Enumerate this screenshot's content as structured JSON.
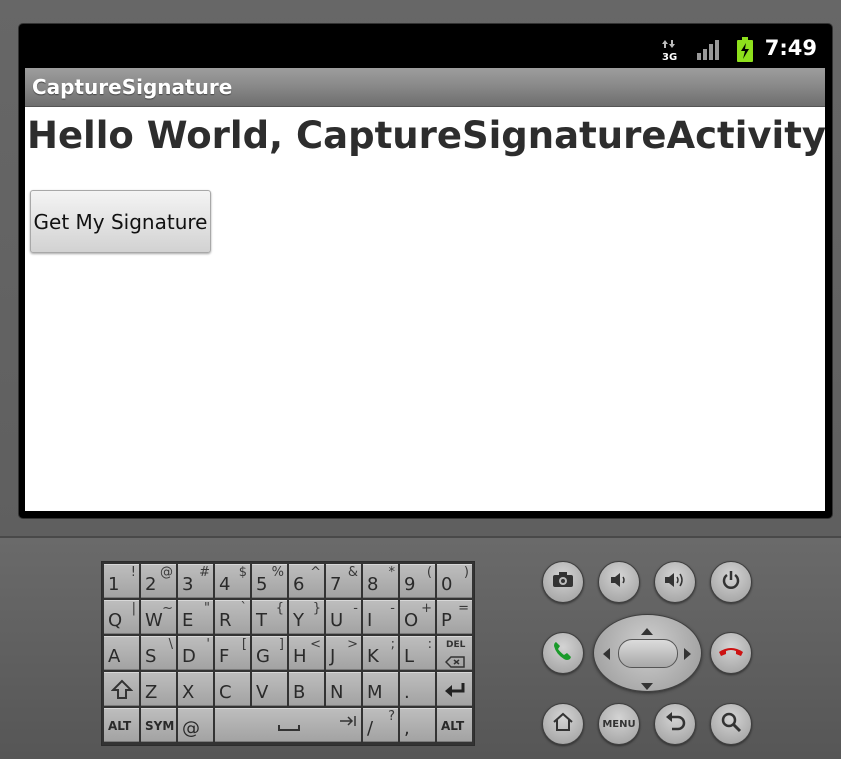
{
  "status_bar": {
    "clock": "7:49",
    "network_type": "3G"
  },
  "app": {
    "title": "CaptureSignature",
    "hello_text": "Hello World, CaptureSignatureActivity!",
    "signature_button": "Get My Signature"
  },
  "keyboard": {
    "rows": [
      [
        [
          "1",
          "!"
        ],
        [
          "2",
          "@"
        ],
        [
          "3",
          "#"
        ],
        [
          "4",
          "$"
        ],
        [
          "5",
          "%"
        ],
        [
          "6",
          "^"
        ],
        [
          "7",
          "&"
        ],
        [
          "8",
          "*"
        ],
        [
          "9",
          "("
        ],
        [
          "0",
          ")"
        ]
      ],
      [
        [
          "Q",
          "|"
        ],
        [
          "W",
          "~"
        ],
        [
          "E",
          "\""
        ],
        [
          "R",
          "`"
        ],
        [
          "T",
          "{"
        ],
        [
          "Y",
          "}"
        ],
        [
          "U",
          "-"
        ],
        [
          "I",
          "-"
        ],
        [
          "O",
          "+"
        ],
        [
          "P",
          "="
        ]
      ],
      [
        [
          "A",
          ""
        ],
        [
          "S",
          "\\"
        ],
        [
          "D",
          "'"
        ],
        [
          "F",
          "["
        ],
        [
          "G",
          "]"
        ],
        [
          "H",
          "<"
        ],
        [
          "J",
          ">"
        ],
        [
          "K",
          ";"
        ],
        [
          "L",
          ":"
        ]
      ],
      [
        [
          "Z",
          ""
        ],
        [
          "X",
          ""
        ],
        [
          "C",
          ""
        ],
        [
          "V",
          ""
        ],
        [
          "B",
          ""
        ],
        [
          "N",
          ""
        ],
        [
          "M",
          ""
        ],
        [
          ".",
          ""
        ]
      ],
      [
        [
          "/",
          "?"
        ],
        [
          ",",
          ""
        ]
      ]
    ],
    "del_label": "DEL",
    "alt_label": "ALT",
    "sym_label": "SYM",
    "at_label": "@"
  },
  "hardware": {
    "menu_label": "MENU"
  },
  "colors": {
    "call_green": "#1a9a2a",
    "end_red": "#cc1111",
    "battery_green": "#8ee01c"
  }
}
